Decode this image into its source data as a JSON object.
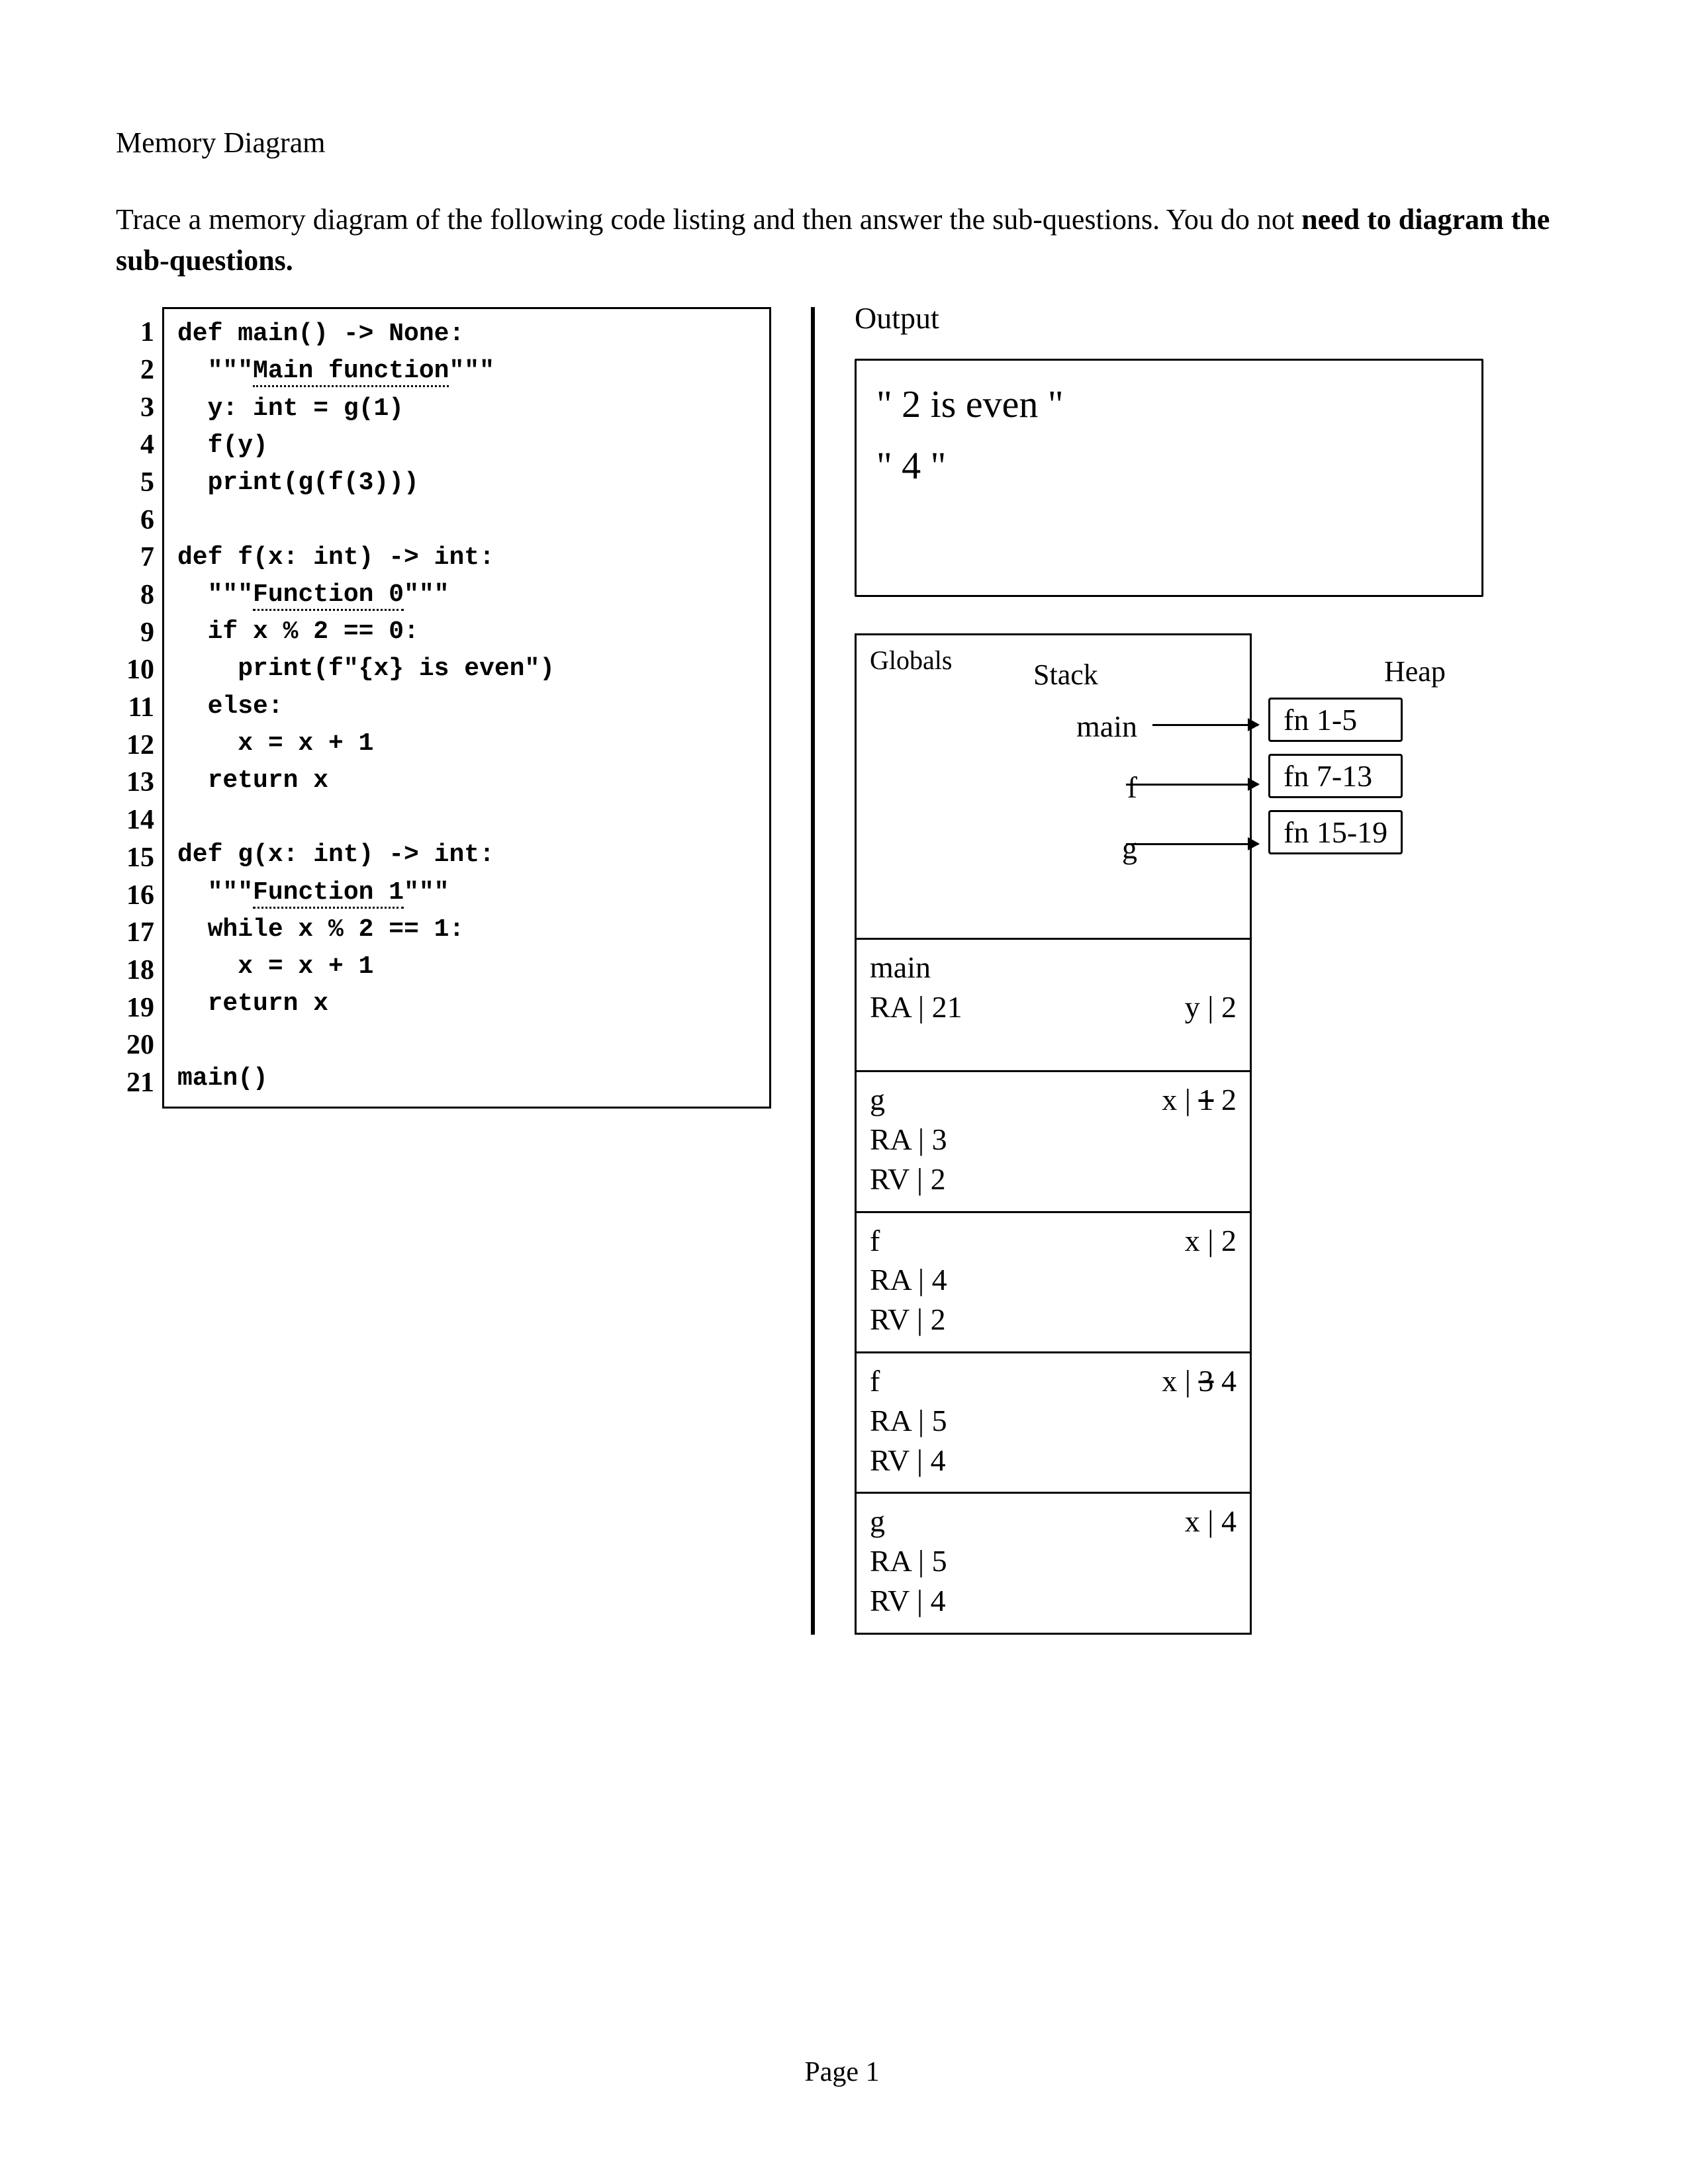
{
  "title": "Memory Diagram",
  "instructions_part1": "Trace a memory diagram of the following code listing and then answer the sub-questions. You do not ",
  "instructions_bold": "need to diagram the sub-questions.",
  "code": {
    "line_numbers": "1\n2\n3\n4\n5\n6\n7\n8\n9\n10\n11\n12\n13\n14\n15\n16\n17\n18\n19\n20\n21",
    "l1": "def main() -> None:",
    "l2a": "  \"\"\"",
    "l2b": "Main function",
    "l2c": "\"\"\"",
    "l3": "  y: int = g(1)",
    "l4": "  f(y)",
    "l5": "  print(g(f(3)))",
    "l6": "",
    "l7": "def f(x: int) -> int:",
    "l8a": "  \"\"\"",
    "l8b": "Function 0",
    "l8c": "\"\"\"",
    "l9": "  if x % 2 == 0:",
    "l10": "    print(f\"{x} is even\")",
    "l11": "  else:",
    "l12": "    x = x + 1",
    "l13": "  return x",
    "l14": "",
    "l15": "def g(x: int) -> int:",
    "l16a": "  \"\"\"",
    "l16b": "Function 1",
    "l16c": "\"\"\"",
    "l17": "  while x % 2 == 1:",
    "l18": "    x = x + 1",
    "l19": "  return x",
    "l20": "",
    "l21": "main()"
  },
  "output": {
    "label": "Output",
    "line1": "\" 2 is even \"",
    "line2": "\" 4 \""
  },
  "labels": {
    "stack": "Stack",
    "heap": "Heap",
    "globals": "Globals"
  },
  "globals": {
    "main": "main",
    "f": "f",
    "g": "g"
  },
  "heap": {
    "fn1": "fn 1-5",
    "fn2": "fn 7-13",
    "fn3": "fn 15-19"
  },
  "frames": {
    "main": {
      "name": "main",
      "ra": "RA | 21",
      "y": "y | 2"
    },
    "g1": {
      "name": "g",
      "ra": "RA | 3",
      "x_old": "1",
      "x_new": "2",
      "rv": "RV | 2"
    },
    "f1": {
      "name": "f",
      "ra": "RA | 4",
      "x": "x | 2",
      "rv": "RV | 2"
    },
    "f2": {
      "name": "f",
      "ra": "RA | 5",
      "x_old": "3",
      "x_new": "4",
      "rv": "RV | 4"
    },
    "g2": {
      "name": "g",
      "ra": "RA | 5",
      "x": "x | 4",
      "rv": "RV | 4"
    }
  },
  "footer": "Page 1"
}
